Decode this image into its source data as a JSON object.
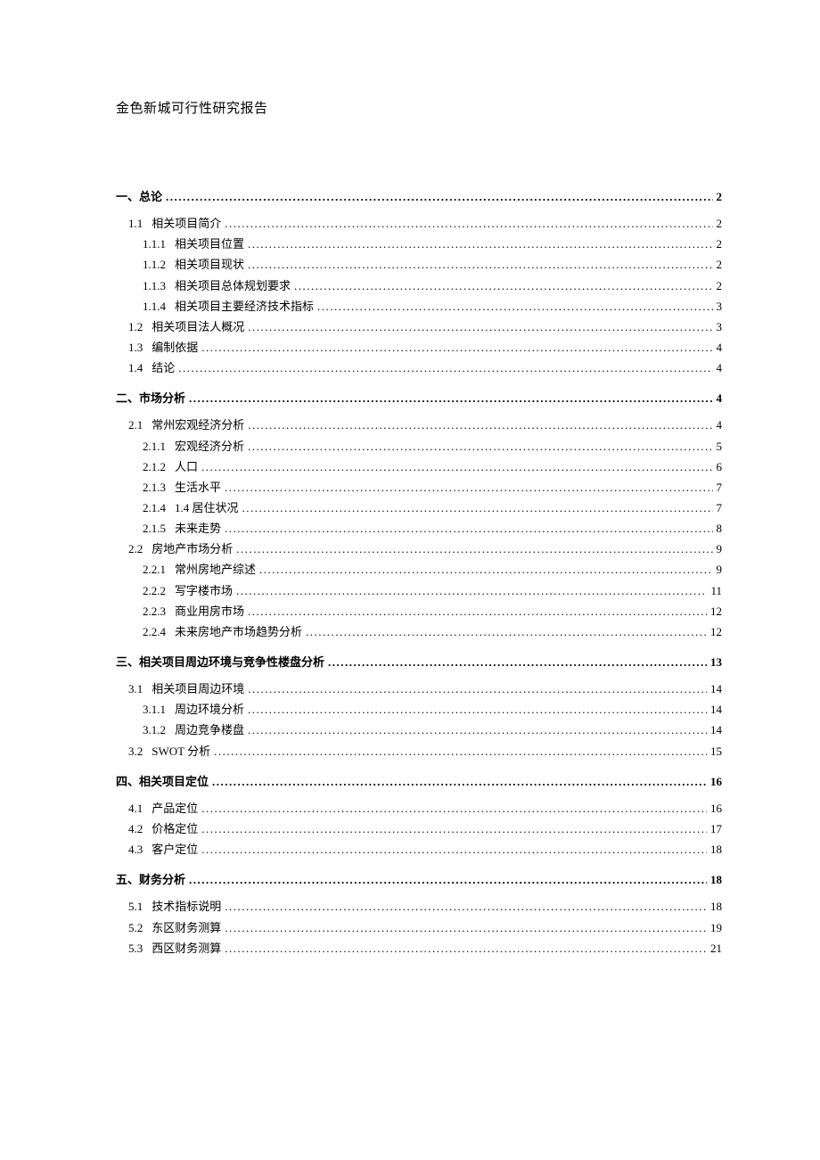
{
  "doc_title": "金色新城可行性研究报告",
  "toc": [
    {
      "level": 1,
      "num": "",
      "label": "一、总论",
      "page": "2"
    },
    {
      "level": 2,
      "num": "1.1",
      "label": "相关项目简介",
      "page": "2"
    },
    {
      "level": 3,
      "num": "1.1.1",
      "label": "相关项目位置",
      "page": "2"
    },
    {
      "level": 3,
      "num": "1.1.2",
      "label": "相关项目现状",
      "page": "2"
    },
    {
      "level": 3,
      "num": "1.1.3",
      "label": "相关项目总体规划要求",
      "page": "2"
    },
    {
      "level": 3,
      "num": "1.1.4",
      "label": "相关项目主要经济技术指标",
      "page": "3"
    },
    {
      "level": 2,
      "num": "1.2",
      "label": "相关项目法人概况",
      "page": "3"
    },
    {
      "level": 2,
      "num": "1.3",
      "label": "编制依据",
      "page": "4"
    },
    {
      "level": 2,
      "num": "1.4",
      "label": "结论",
      "page": "4"
    },
    {
      "level": 1,
      "num": "",
      "label": "二、市场分析",
      "page": "4"
    },
    {
      "level": 2,
      "num": "2.1",
      "label": "常州宏观经济分析",
      "page": "4"
    },
    {
      "level": 3,
      "num": "2.1.1",
      "label": "宏观经济分析",
      "page": "5"
    },
    {
      "level": 3,
      "num": "2.1.2",
      "label": "人口",
      "page": "6"
    },
    {
      "level": 3,
      "num": "2.1.3",
      "label": "生活水平",
      "page": "7"
    },
    {
      "level": 3,
      "num": "2.1.4",
      "label": "1.4 居住状况",
      "page": "7"
    },
    {
      "level": 3,
      "num": "2.1.5",
      "label": "未来走势",
      "page": "8"
    },
    {
      "level": 2,
      "num": "2.2",
      "label": "房地产市场分析",
      "page": "9"
    },
    {
      "level": 3,
      "num": "2.2.1",
      "label": "常州房地产综述",
      "page": "9"
    },
    {
      "level": 3,
      "num": "2.2.2",
      "label": "写字楼市场",
      "page": "11"
    },
    {
      "level": 3,
      "num": "2.2.3",
      "label": "商业用房市场",
      "page": "12"
    },
    {
      "level": 3,
      "num": "2.2.4",
      "label": "未来房地产市场趋势分析",
      "page": "12"
    },
    {
      "level": 1,
      "num": "",
      "label": "三、相关项目周边环境与竞争性楼盘分析",
      "page": "13"
    },
    {
      "level": 2,
      "num": "3.1",
      "label": "相关项目周边环境",
      "page": "14"
    },
    {
      "level": 3,
      "num": "3.1.1",
      "label": "周边环境分析",
      "page": "14"
    },
    {
      "level": 3,
      "num": "3.1.2",
      "label": "周边竞争楼盘",
      "page": "14"
    },
    {
      "level": 2,
      "num": "3.2",
      "label": "SWOT 分析",
      "page": "15"
    },
    {
      "level": 1,
      "num": "",
      "label": "四、相关项目定位",
      "page": "16"
    },
    {
      "level": 2,
      "num": "4.1",
      "label": "产品定位",
      "page": "16"
    },
    {
      "level": 2,
      "num": "4.2",
      "label": "价格定位",
      "page": "17"
    },
    {
      "level": 2,
      "num": "4.3",
      "label": "客户定位",
      "page": "18"
    },
    {
      "level": 1,
      "num": "",
      "label": "五、财务分析",
      "page": "18"
    },
    {
      "level": 2,
      "num": "5.1",
      "label": "技术指标说明",
      "page": "18"
    },
    {
      "level": 2,
      "num": "5.2",
      "label": "东区财务测算",
      "page": "19"
    },
    {
      "level": 2,
      "num": "5.3",
      "label": "西区财务测算",
      "page": "21"
    }
  ]
}
